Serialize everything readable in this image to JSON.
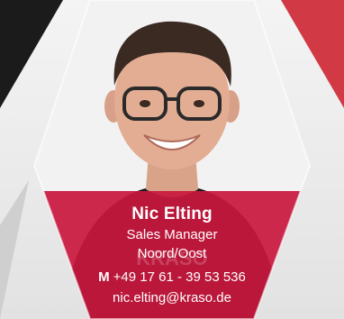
{
  "profile": {
    "name": "Nic Elting",
    "title": "Sales Manager",
    "region": "Noord/Oost",
    "phone_prefix": "M",
    "phone": "+49 17 61 - 39 53 536",
    "email": "nic.elting@kraso.de"
  },
  "colors": {
    "card_red": "#c8173d",
    "card_red_overlay": "#d0244a",
    "dark_corner": "#1b1b1b",
    "red_corner": "#d13a44",
    "light_bg": "#ececec"
  }
}
